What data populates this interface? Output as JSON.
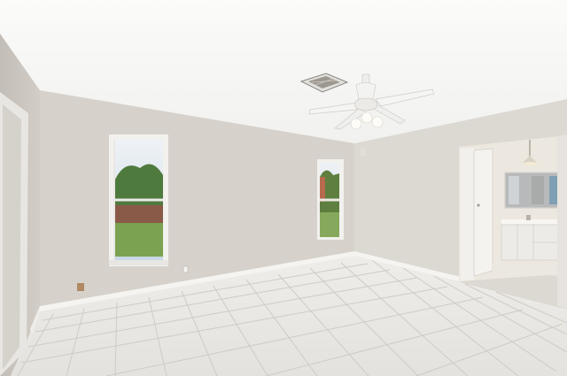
{
  "scene": {
    "kind": "empty-room-interior",
    "features": [
      "ceiling-fan",
      "air-vent",
      "window-left",
      "window-center",
      "doorway-bathroom",
      "tile-floor",
      "vanity-mirror",
      "pendant-light"
    ]
  },
  "colors": {
    "ceiling": "#f7f7f5",
    "wall_left": "#cfcac3",
    "wall_back": "#d8d4cd",
    "wall_right": "#dedbd5",
    "floor": "#ebe9e5",
    "grout": "#cbc7c0",
    "baseboard": "#f4f3f0",
    "sky": "#d6e2ee",
    "foliage": "#4f7a3e",
    "lawn": "#7aa251",
    "bathroom_wall": "#ede8df"
  }
}
